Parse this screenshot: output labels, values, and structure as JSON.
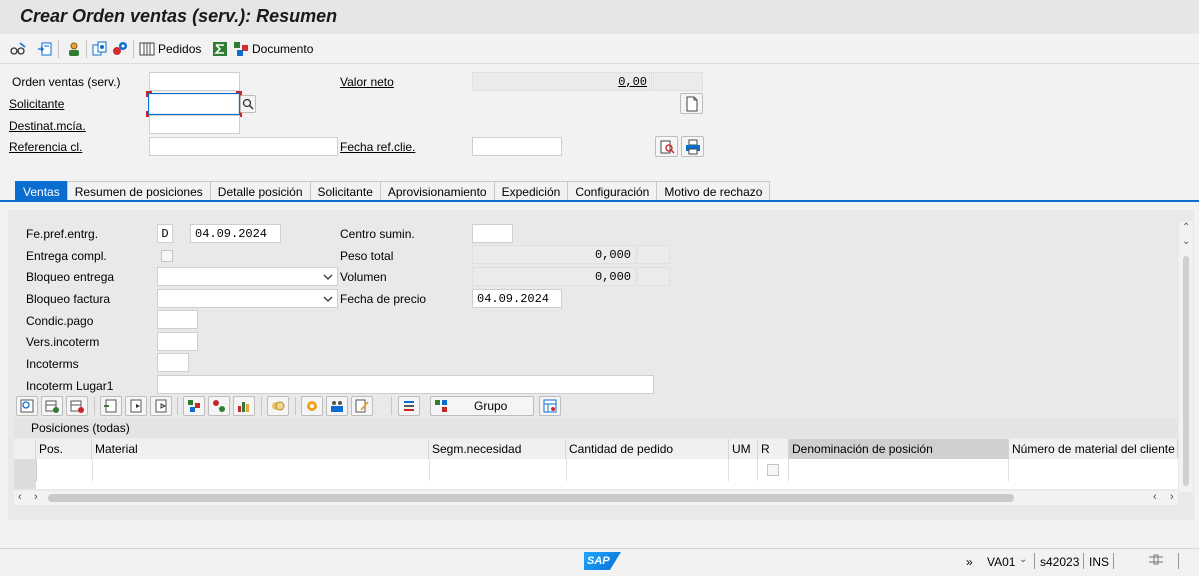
{
  "window": {
    "title": "Crear Orden ventas (serv.): Resumen"
  },
  "toolbar": {
    "orders_label": "Pedidos",
    "document_label": "Documento"
  },
  "header": {
    "order_label": "Orden ventas (serv.)",
    "order_value": "",
    "net_value_label": "Valor neto",
    "net_value": "0,00",
    "currency": "",
    "sold_to_label": "Solicitante",
    "sold_to_value": "",
    "ship_to_label": "Destinat.mcía.",
    "ship_to_value": "",
    "cust_ref_label": "Referencia cl.",
    "cust_ref_value": "",
    "cust_ref_date_label": "Fecha ref.clie.",
    "cust_ref_date_value": ""
  },
  "tabs": [
    {
      "label": "Ventas",
      "active": true
    },
    {
      "label": "Resumen de posiciones"
    },
    {
      "label": "Detalle posición"
    },
    {
      "label": "Solicitante"
    },
    {
      "label": "Aprovisionamiento"
    },
    {
      "label": "Expedición"
    },
    {
      "label": "Configuración"
    },
    {
      "label": "Motivo de rechazo"
    }
  ],
  "sales": {
    "req_delivery_date_label": "Fe.pref.entrg.",
    "req_delivery_date_type": "D",
    "req_delivery_date": "04.09.2024",
    "complete_delivery_label": "Entrega compl.",
    "delivery_block_label": "Bloqueo entrega",
    "delivery_block_value": "",
    "billing_block_label": "Bloqueo factura",
    "billing_block_value": "",
    "payment_terms_label": "Condic.pago",
    "payment_terms_value": "",
    "incoterm_version_label": "Vers.incoterm",
    "incoterm_version_value": "",
    "incoterms_label": "Incoterms",
    "incoterms_value": "",
    "incoterm_location_label": "Incoterm Lugar1",
    "incoterm_location_value": "",
    "delivering_plant_label": "Centro sumin.",
    "delivering_plant_value": "",
    "total_weight_label": "Peso total",
    "total_weight": "0,000",
    "volume_label": "Volumen",
    "volume": "0,000",
    "pricing_date_label": "Fecha de precio",
    "pricing_date": "04.09.2024"
  },
  "items": {
    "group_button": "Grupo",
    "section_title": "Posiciones (todas)",
    "columns": [
      "Pos.",
      "Material",
      "Segm.necesidad",
      "Cantidad de pedido",
      "UM",
      "R",
      "Denominación de posición",
      "Número de material del cliente"
    ]
  },
  "status": {
    "transaction": "VA01",
    "server": "s42023",
    "mode": "INS",
    "chevrons": "»",
    "logo": "SAP"
  }
}
